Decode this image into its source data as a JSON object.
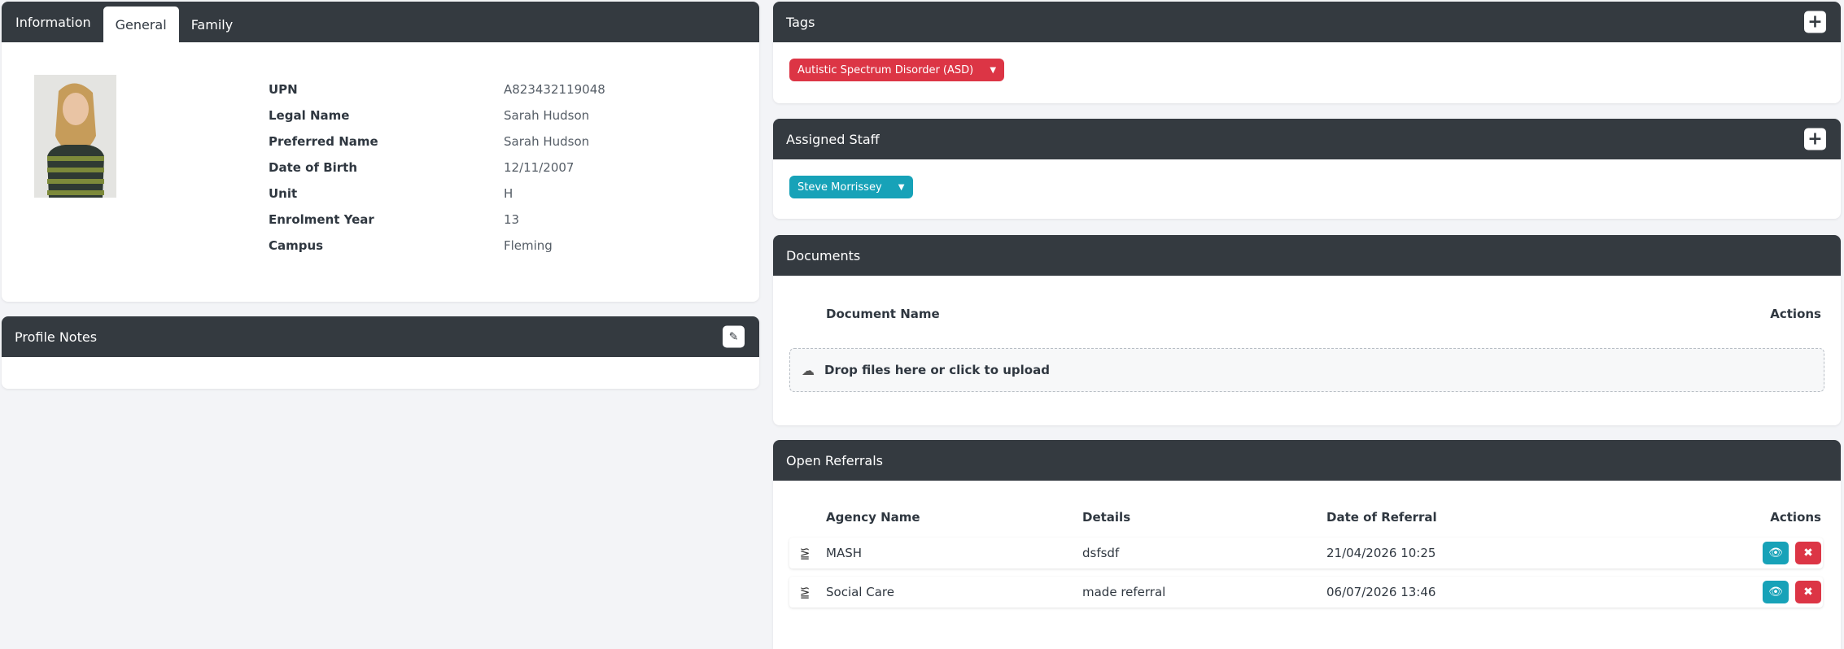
{
  "info": {
    "tabs": [
      "Information",
      "General",
      "Family"
    ],
    "fields": [
      {
        "label": "UPN",
        "value": "A823432119048"
      },
      {
        "label": "Legal Name",
        "value": "Sarah Hudson"
      },
      {
        "label": "Preferred Name",
        "value": "Sarah Hudson"
      },
      {
        "label": "Date of Birth",
        "value": "12/11/2007"
      },
      {
        "label": "Unit",
        "value": "H"
      },
      {
        "label": "Enrolment Year",
        "value": "13"
      },
      {
        "label": "Campus",
        "value": "Fleming"
      }
    ]
  },
  "notes": {
    "title": "Profile Notes"
  },
  "tags": {
    "title": "Tags",
    "items": [
      "Autistic Spectrum Disorder (ASD)"
    ]
  },
  "staff": {
    "title": "Assigned Staff",
    "items": [
      "Steve Morrissey"
    ]
  },
  "documents": {
    "title": "Documents",
    "col_name": "Document Name",
    "col_actions": "Actions",
    "dropzone": "Drop files here or click to upload"
  },
  "referrals": {
    "title": "Open Referrals",
    "cols": [
      "Agency Name",
      "Details",
      "Date of Referral",
      "Actions"
    ],
    "rows": [
      {
        "agency": "MASH",
        "details": "dsfsdf",
        "date": "21/04/2026 10:25"
      },
      {
        "agency": "Social Care",
        "details": "made referral",
        "date": "06/07/2026 13:46"
      }
    ]
  },
  "colors": {
    "header": "#343a40",
    "danger": "#dc3545",
    "info": "#17a2b8"
  }
}
